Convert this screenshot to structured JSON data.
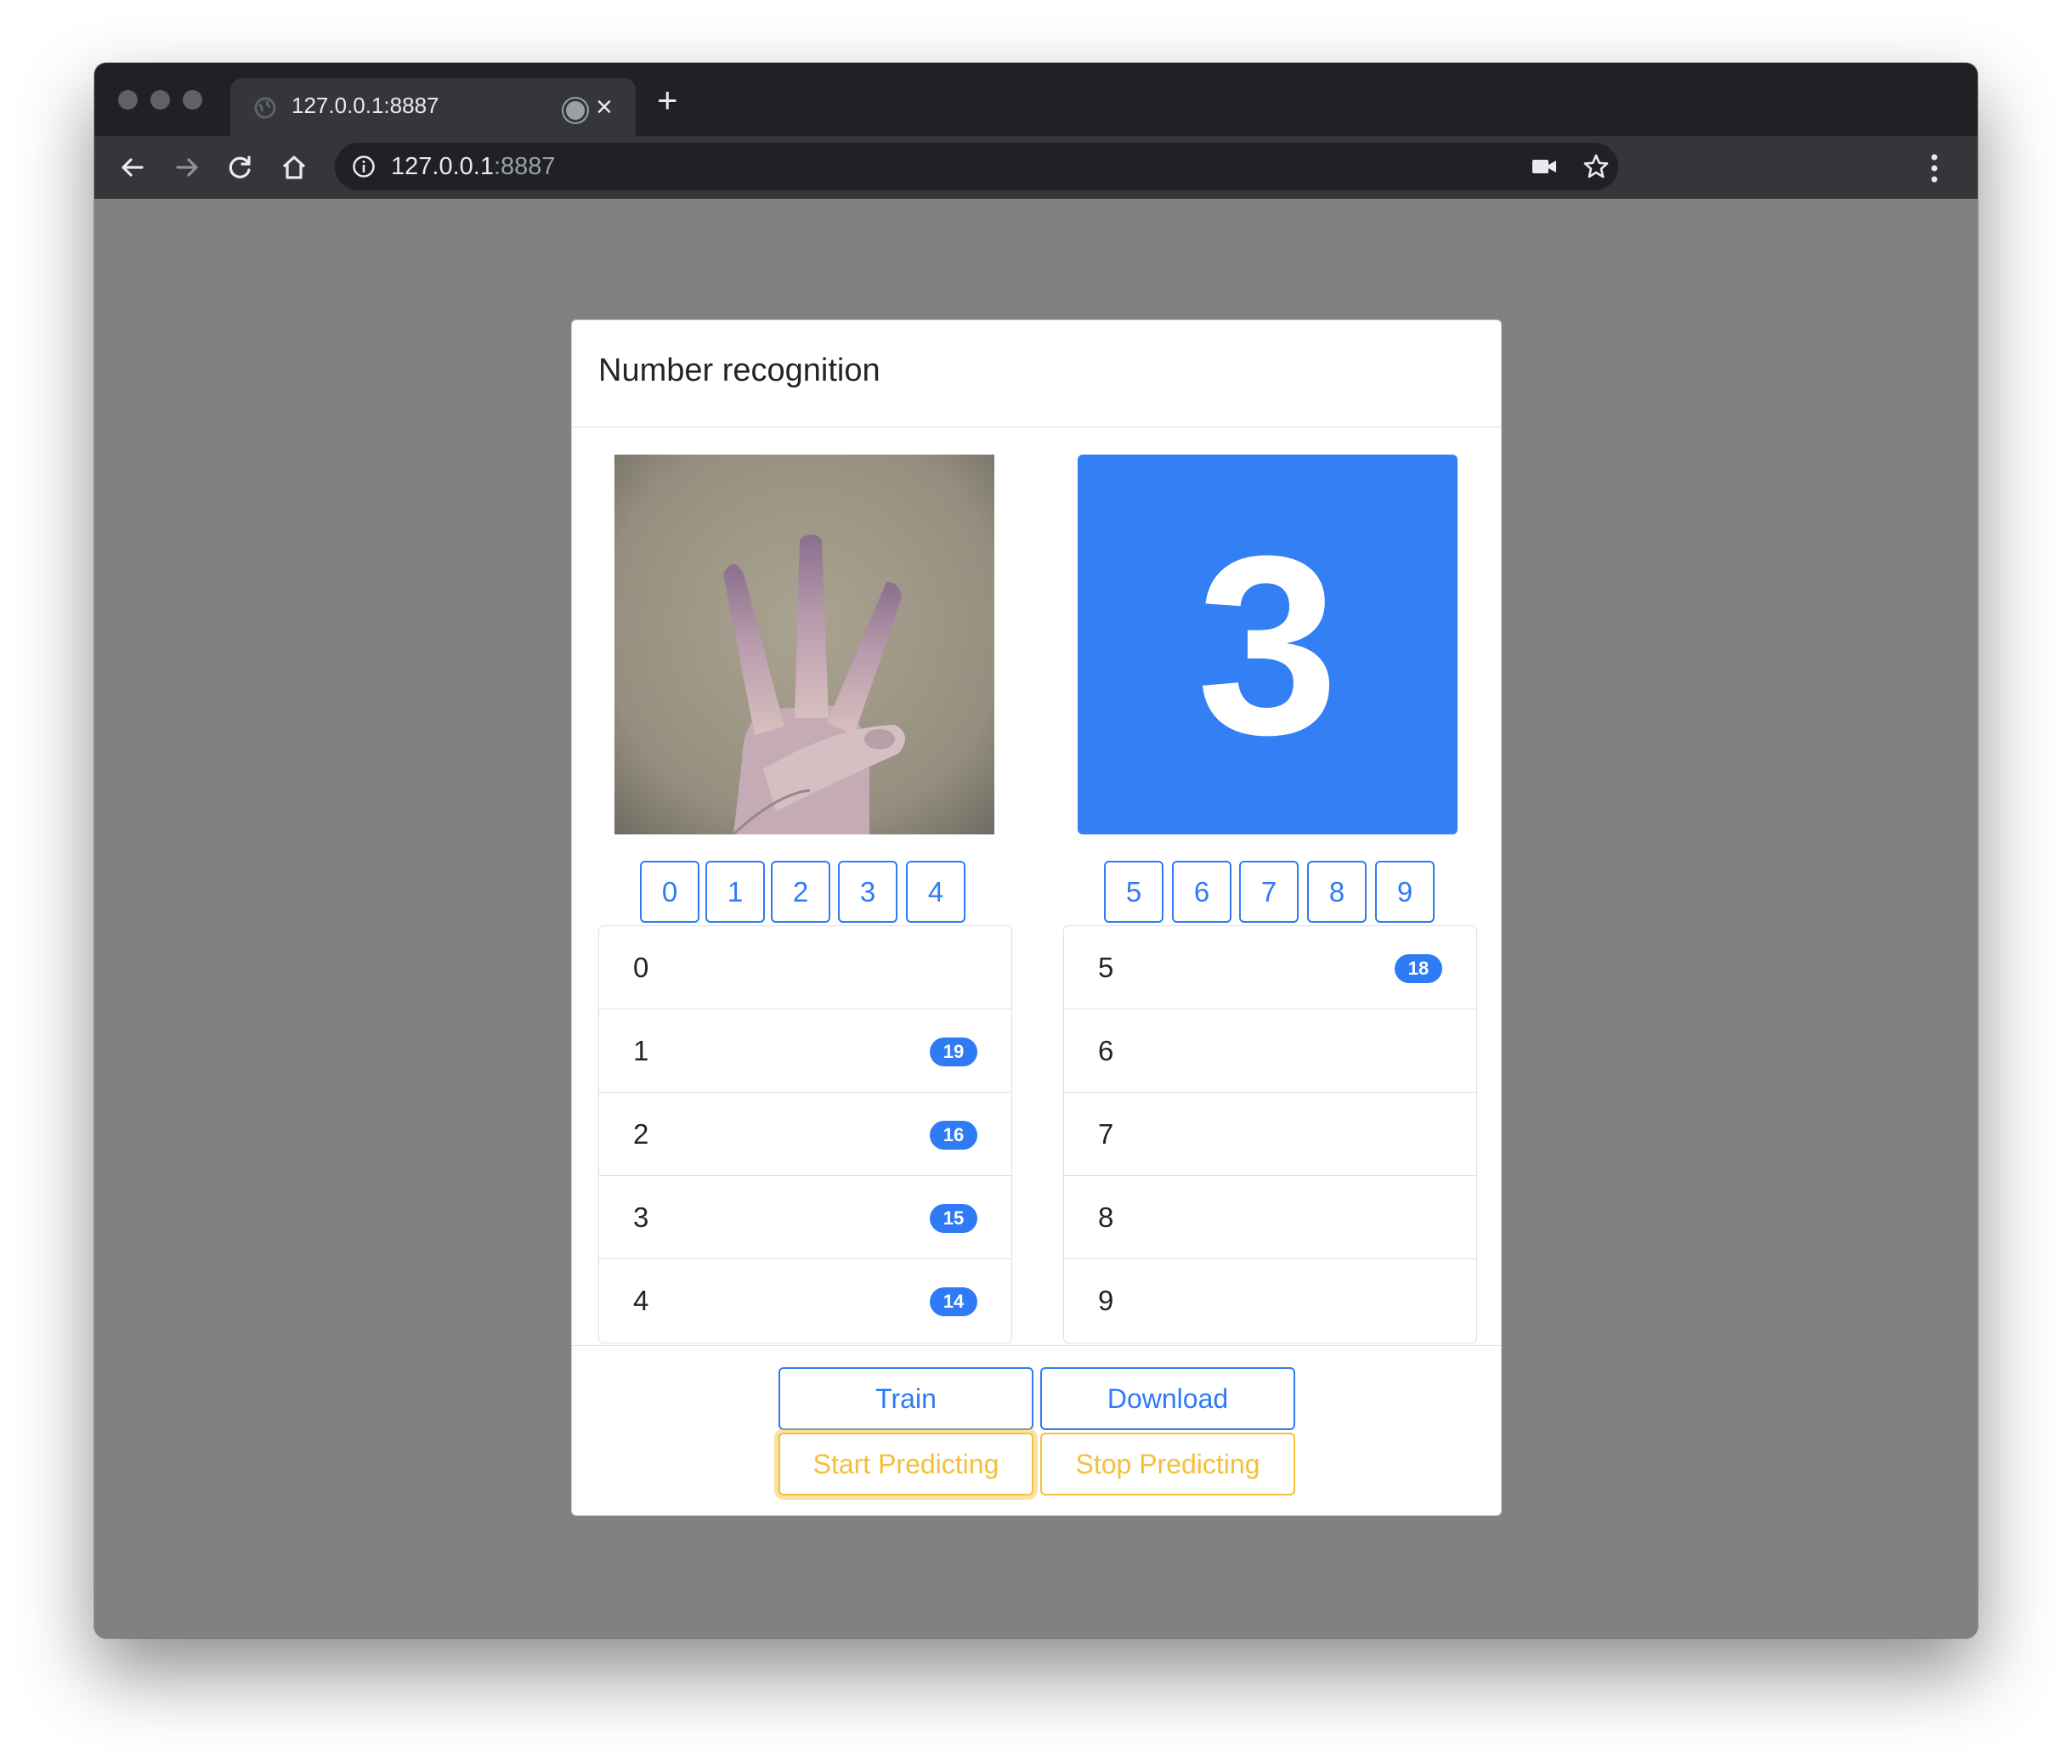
{
  "browser": {
    "tab_title": "127.0.0.1:8887",
    "url_host": "127.0.0.1",
    "url_port": ":8887",
    "icons": [
      "back-arrow-icon",
      "forward-arrow-icon",
      "reload-icon",
      "home-icon",
      "info-icon",
      "camera-icon",
      "star-icon",
      "menu-dots-icon",
      "close-icon",
      "plus-icon"
    ]
  },
  "card": {
    "title": "Number recognition",
    "prediction": "3",
    "left_buttons": [
      "0",
      "1",
      "2",
      "3",
      "4"
    ],
    "right_buttons": [
      "5",
      "6",
      "7",
      "8",
      "9"
    ],
    "left_list": [
      {
        "label": "0",
        "count": ""
      },
      {
        "label": "1",
        "count": "19"
      },
      {
        "label": "2",
        "count": "16"
      },
      {
        "label": "3",
        "count": "15"
      },
      {
        "label": "4",
        "count": "14"
      }
    ],
    "right_list": [
      {
        "label": "5",
        "count": "18"
      },
      {
        "label": "6",
        "count": ""
      },
      {
        "label": "7",
        "count": ""
      },
      {
        "label": "8",
        "count": ""
      },
      {
        "label": "9",
        "count": ""
      }
    ],
    "actions": {
      "train": "Train",
      "download": "Download",
      "start": "Start Predicting",
      "stop": "Stop Predicting"
    }
  },
  "colors": {
    "primary": "#2f7bf5",
    "warning": "#f5bf3a",
    "page_bg": "#818181",
    "chrome_dark": "#202124"
  }
}
